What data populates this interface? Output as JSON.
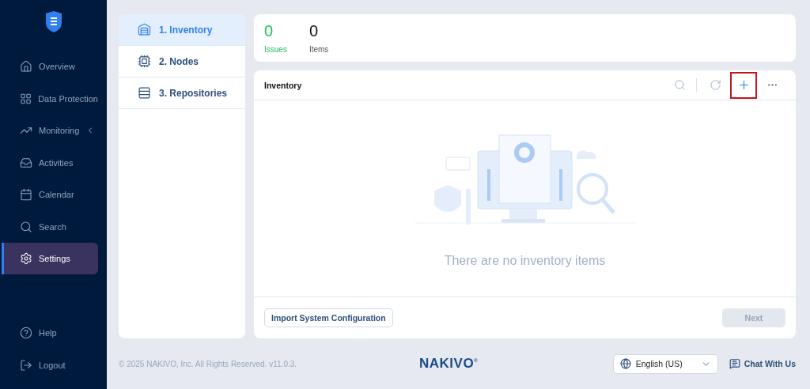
{
  "sidebar": {
    "items": [
      {
        "label": "Overview",
        "selected": false
      },
      {
        "label": "Data Protection",
        "selected": false
      },
      {
        "label": "Monitoring",
        "selected": false,
        "expandable": true
      },
      {
        "label": "Activities",
        "selected": false
      },
      {
        "label": "Calendar",
        "selected": false
      },
      {
        "label": "Search",
        "selected": false
      },
      {
        "label": "Settings",
        "selected": true
      }
    ],
    "bottom_items": [
      {
        "label": "Help",
        "selected": false
      },
      {
        "label": "Logout",
        "selected": false
      }
    ]
  },
  "steps": [
    {
      "label": "1. Inventory",
      "selected": true
    },
    {
      "label": "2. Nodes",
      "selected": false
    },
    {
      "label": "3. Repositories",
      "selected": false
    }
  ],
  "stats": [
    {
      "value": "0",
      "label": "Issues",
      "kind": "ok"
    },
    {
      "value": "0",
      "label": "Items",
      "kind": "plain"
    }
  ],
  "inventory": {
    "title": "Inventory",
    "tools": [
      {
        "highlighted": false
      },
      {
        "highlighted": false
      },
      {
        "highlighted": true
      },
      {
        "highlighted": false
      }
    ],
    "empty_text": "There are no inventory items",
    "import_button": "Import System Configuration",
    "next_button": {
      "label": "Next",
      "disabled": true
    }
  },
  "footer": {
    "copyright": "© 2025 NAKIVO, Inc. All Rights Reserved. v11.0.3.",
    "logo": "NAKIVO$^{®}$",
    "language": "English (US)",
    "chat": "Chat With Us"
  }
}
